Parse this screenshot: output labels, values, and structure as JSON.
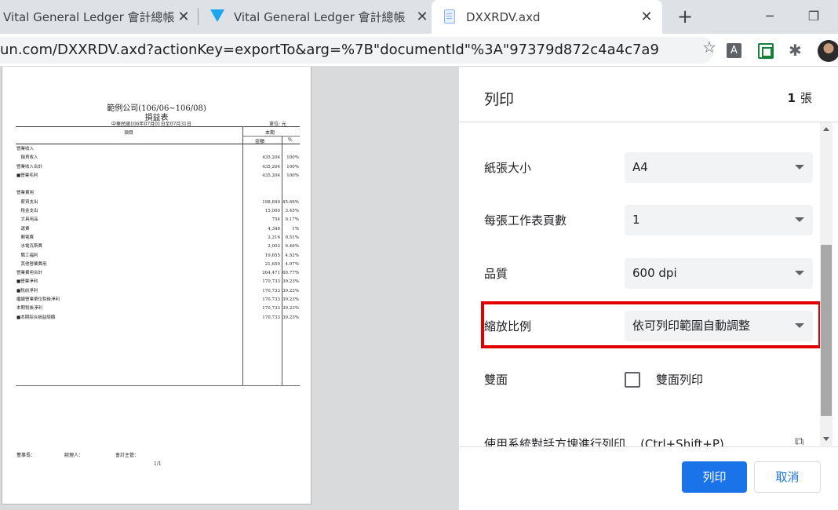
{
  "browser": {
    "tabs": [
      {
        "title": "Vital General Ledger 會計總帳",
        "close": "✕"
      },
      {
        "title": "Vital General Ledger 會計總帳",
        "close": "✕"
      },
      {
        "title": "DXXRDV.axd",
        "close": "✕"
      }
    ],
    "new_tab": "+",
    "minimize": "─",
    "restore": "❐",
    "url": "un.com/DXXRDV.axd?actionKey=exportTo&arg=%7B\"documentId\"%3A\"97379d872c4a4c7a9f4283e4...",
    "star": "☆",
    "ext_a": "A",
    "puzzle": "✱"
  },
  "report": {
    "company": "範例公司(106/06~106/08)",
    "title": "損益表",
    "date_range": "中華民國106年07月01日至07月31日",
    "unit": "單位: 元",
    "col_item": "項目",
    "col_period": "本期",
    "col_amount": "金額",
    "col_pct": "%",
    "rows": [
      {
        "label": "營業收入",
        "amount": "",
        "pct": ""
      },
      {
        "label": "　銷貨收入",
        "amount": "435,204",
        "pct": "100%"
      },
      {
        "label": "營業收入合計",
        "amount": "435,204",
        "pct": "100%"
      },
      {
        "label": "■營業毛利",
        "amount": "435,204",
        "pct": "100%"
      },
      {
        "label": "",
        "amount": "",
        "pct": ""
      },
      {
        "label": "營業費用",
        "amount": "",
        "pct": ""
      },
      {
        "label": "　薪資支出",
        "amount": "198,849",
        "pct": "45.69%"
      },
      {
        "label": "　租金支出",
        "amount": "15,000",
        "pct": "3.45%"
      },
      {
        "label": "　文具用品",
        "amount": "754",
        "pct": "0.17%"
      },
      {
        "label": "　運費",
        "amount": "4,346",
        "pct": "1%"
      },
      {
        "label": "　郵電費",
        "amount": "2,216",
        "pct": "0.51%"
      },
      {
        "label": "　水電瓦斯費",
        "amount": "2,002",
        "pct": "0.46%"
      },
      {
        "label": "　職工福利",
        "amount": "19,655",
        "pct": "4.52%"
      },
      {
        "label": "　其他營業費用",
        "amount": "21,650",
        "pct": "4.97%"
      },
      {
        "label": "營業費用合計",
        "amount": "264,471",
        "pct": "60.77%"
      },
      {
        "label": "■營業淨利",
        "amount": "170,733",
        "pct": "39.23%"
      },
      {
        "label": "■稅前淨利",
        "amount": "170,733",
        "pct": "39.23%"
      },
      {
        "label": "繼續營業單位稅後淨利",
        "amount": "170,733",
        "pct": "39.23%"
      },
      {
        "label": "本期稅後淨利",
        "amount": "170,733",
        "pct": "39.23%"
      },
      {
        "label": "■本期綜合損益總額",
        "amount": "170,733",
        "pct": "39.23%"
      }
    ],
    "sig_chairman": "董事長：",
    "sig_manager": "經理人：",
    "sig_accountant": "會計主管：",
    "page": "1/1"
  },
  "print_panel": {
    "title": "列印",
    "sheet_count": "1",
    "sheet_unit": "張",
    "settings": [
      {
        "label": "紙張大小",
        "value": "A4"
      },
      {
        "label": "每張工作表頁數",
        "value": "1"
      },
      {
        "label": "品質",
        "value": "600 dpi"
      },
      {
        "label": "縮放比例",
        "value": "依可列印範圍自動調整"
      }
    ],
    "duplex_label": "雙面",
    "duplex_option": "雙面列印",
    "duplex_checked": false,
    "system_dialog": "使用系統對話方塊進行列印... (Ctrl+Shift+P)",
    "external_icon": "⧉",
    "print_button": "列印",
    "cancel_button": "取消",
    "accent_color": "#1a73e8",
    "highlight_color": "#e00000"
  }
}
